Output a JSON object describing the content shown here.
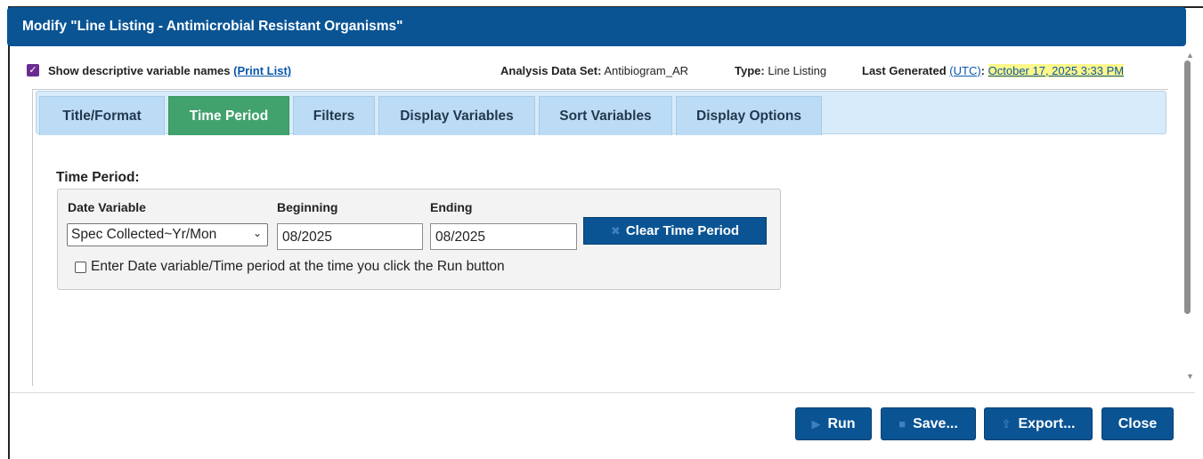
{
  "dialog": {
    "title": "Modify \"Line Listing - Antimicrobial Resistant Organisms\""
  },
  "infobar": {
    "show_descriptive": "Show descriptive variable names",
    "print_list": "(Print List)",
    "analysis_label": "Analysis Data Set:",
    "analysis_value": "Antibiogram_AR",
    "type_label": "Type:",
    "type_value": "Line Listing",
    "last_generated_label": "Last Generated",
    "utc": "(UTC)",
    "colon": ":",
    "last_generated_value": "October 17, 2025 3:33 PM",
    "show_descriptive_checked": true
  },
  "tabs": [
    {
      "label": "Title/Format",
      "active": false
    },
    {
      "label": "Time Period",
      "active": true
    },
    {
      "label": "Filters",
      "active": false
    },
    {
      "label": "Display Variables",
      "active": false
    },
    {
      "label": "Sort Variables",
      "active": false
    },
    {
      "label": "Display Options",
      "active": false
    }
  ],
  "time_period": {
    "section_label": "Time Period:",
    "date_variable_label": "Date Variable",
    "date_variable_value": "Spec Collected~Yr/Mon",
    "beginning_label": "Beginning",
    "beginning_value": "08/2025",
    "ending_label": "Ending",
    "ending_value": "08/2025",
    "clear_button": "Clear Time Period",
    "enter_at_run_label": "Enter Date variable/Time period at the time you click the Run button",
    "enter_at_run_checked": false
  },
  "footer": {
    "run": "Run",
    "save": "Save...",
    "export": "Export...",
    "close": "Close"
  },
  "colors": {
    "primary": "#0a5494",
    "active_tab": "#42a26d",
    "tab_bg": "#bcdcf6",
    "highlight": "#fff78a",
    "checkbox": "#6a2c91"
  }
}
